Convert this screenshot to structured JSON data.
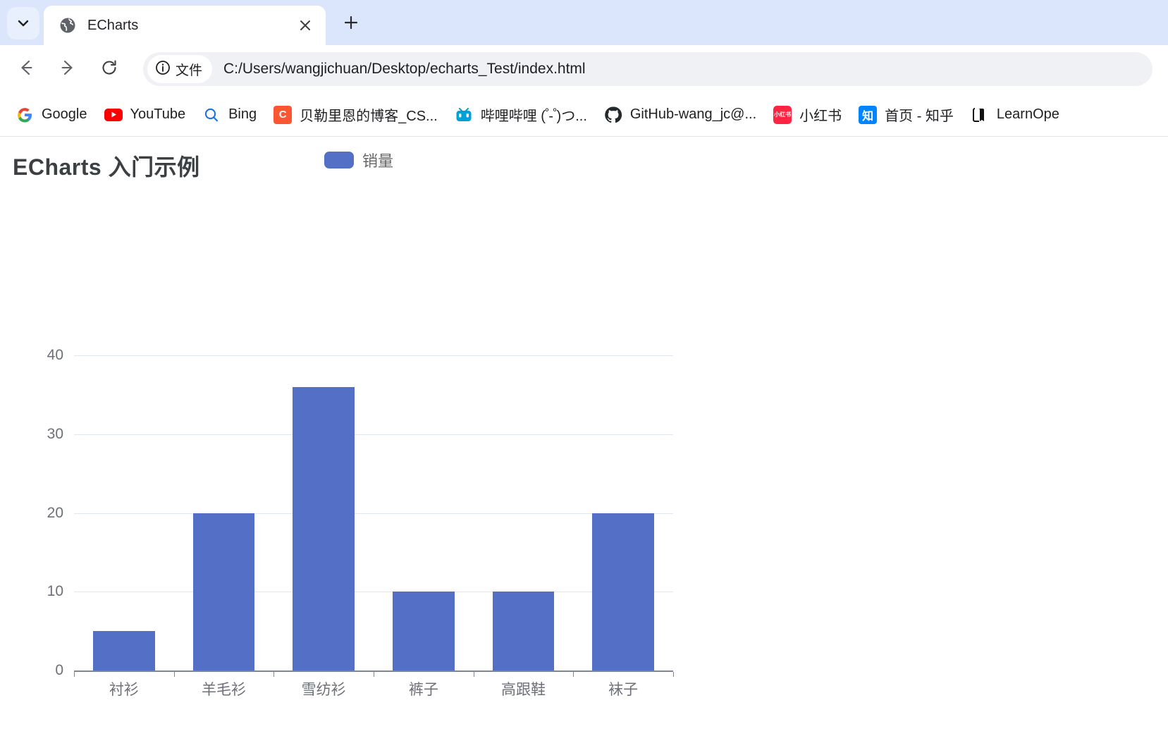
{
  "browser": {
    "tab_search_icon": "chevron-down-icon",
    "tab": {
      "favicon": "globe-icon",
      "title": "ECharts",
      "close_icon": "close-icon"
    },
    "new_tab_icon": "plus-icon",
    "toolbar": {
      "back_icon": "back-arrow-icon",
      "forward_icon": "forward-arrow-icon",
      "reload_icon": "reload-icon",
      "info_icon": "info-circle-icon",
      "file_chip_label": "文件",
      "url": "C:/Users/wangjichuan/Desktop/echarts_Test/index.html"
    },
    "bookmarks": [
      {
        "label": "Google",
        "icon": "google-icon",
        "icon_text": "G",
        "icon_color": "#ffffff",
        "text_color": "#4285f4"
      },
      {
        "label": "YouTube",
        "icon": "youtube-icon",
        "icon_text": "▶",
        "icon_color": "#ff0000",
        "text_color": "#ffffff"
      },
      {
        "label": "Bing",
        "icon": "bing-search-icon",
        "icon_text": "Q",
        "icon_color": "#ffffff",
        "text_color": "#1a73e8"
      },
      {
        "label": "贝勒里恩的博客_CS...",
        "icon": "csdn-icon",
        "icon_text": "C",
        "icon_color": "#fc5531",
        "text_color": "#ffffff"
      },
      {
        "label": "哔哩哔哩 ( ゚- ゚)つ...",
        "icon": "bilibili-icon",
        "icon_text": "□",
        "icon_color": "#00a1d6",
        "text_color": "#ffffff"
      },
      {
        "label": "GitHub-wang_jc@...",
        "icon": "github-icon",
        "icon_text": "●",
        "icon_color": "#ffffff",
        "text_color": "#24292e"
      },
      {
        "label": "小红书",
        "icon": "xiaohongshu-icon",
        "icon_text": "小红书",
        "icon_color": "#fe2442",
        "text_color": "#ffffff"
      },
      {
        "label": "首页 - 知乎",
        "icon": "zhihu-icon",
        "icon_text": "知",
        "icon_color": "#0084ff",
        "text_color": "#ffffff"
      },
      {
        "label": "LearnOpe",
        "icon": "book-icon",
        "icon_text": "▮",
        "icon_color": "#ffffff",
        "text_color": "#111111"
      }
    ]
  },
  "page": {
    "title": "ECharts 入门示例"
  },
  "chart_data": {
    "type": "bar",
    "title": "ECharts 入门示例",
    "categories": [
      "衬衫",
      "羊毛衫",
      "雪纺衫",
      "裤子",
      "高跟鞋",
      "袜子"
    ],
    "series": [
      {
        "name": "销量",
        "values": [
          5,
          20,
          36,
          10,
          10,
          20
        ],
        "color": "#5470c6"
      }
    ],
    "legend": [
      "销量"
    ],
    "legend_position": "top-center",
    "xlabel": "",
    "ylabel": "",
    "ylim": [
      0,
      40
    ],
    "yticks": [
      0,
      10,
      20,
      30,
      40
    ],
    "grid": true,
    "grid_color": "#e0e6f1"
  }
}
